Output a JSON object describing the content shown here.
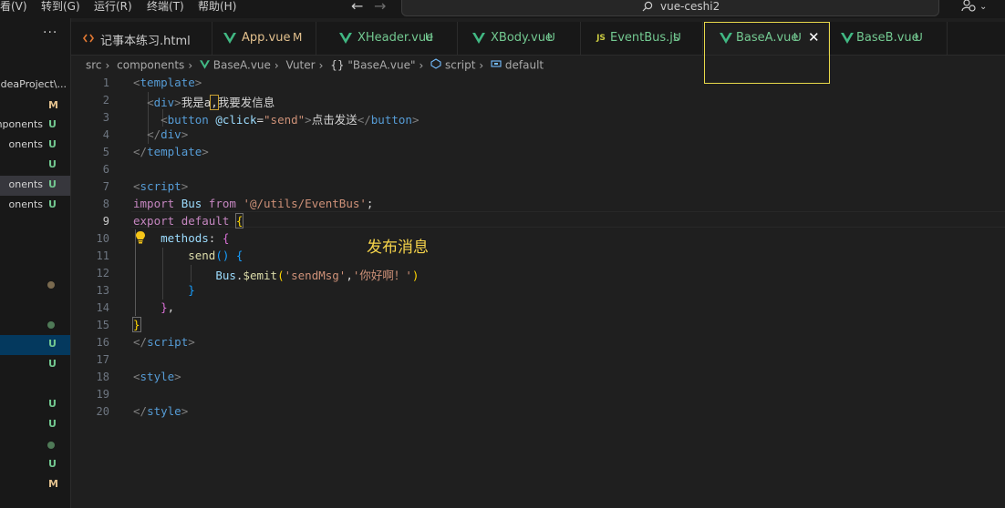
{
  "menu": [
    "看(V)",
    "转到(G)",
    "运行(R)",
    "终端(T)",
    "帮助(H)"
  ],
  "command_center": {
    "text": "vue-ceshi2"
  },
  "sidebar": {
    "rows": [
      {
        "label": "",
        "status": "M",
        "kind": "m"
      },
      {
        "label": "IdeaProject\\...",
        "status": "",
        "kind": ""
      },
      {
        "label": "mponents",
        "status": "U",
        "kind": "u"
      },
      {
        "label": "onents",
        "status": "U",
        "kind": "u"
      },
      {
        "label": "",
        "status": "U",
        "kind": "u"
      },
      {
        "label": "onents",
        "status": "U",
        "kind": "u"
      },
      {
        "label": "onents",
        "status": "U",
        "kind": "u"
      }
    ],
    "lower_status": [
      "U",
      "U",
      "U",
      "U",
      "U",
      "M"
    ]
  },
  "tabs": [
    {
      "label": "记事本练习.html",
      "status": "",
      "icon": "html-icon"
    },
    {
      "label": "App.vue",
      "status": "M",
      "icon": "vue-icon"
    },
    {
      "label": "XHeader.vue",
      "status": "U",
      "icon": "vue-icon"
    },
    {
      "label": "XBody.vue",
      "status": "U",
      "icon": "vue-icon"
    },
    {
      "label": "EventBus.js",
      "status": "U",
      "icon": "js-icon"
    },
    {
      "label": "BaseA.vue",
      "status": "U",
      "icon": "vue-icon"
    },
    {
      "label": "BaseB.vue",
      "status": "U",
      "icon": "vue-icon"
    }
  ],
  "tabs_js_badge": "JS",
  "breadcrumb": {
    "items": [
      "src",
      "components",
      "BaseA.vue",
      "Vuter",
      "\"BaseA.vue\"",
      "script",
      "default"
    ],
    "obj_prefix": "{}"
  },
  "editor": {
    "line_numbers": [
      "1",
      "2",
      "3",
      "4",
      "5",
      "6",
      "7",
      "8",
      "9",
      "10",
      "11",
      "12",
      "13",
      "14",
      "15",
      "16",
      "17",
      "18",
      "19",
      "20"
    ],
    "current_line": "9",
    "annotation": "发布消息",
    "tokens": {
      "tag_template": "template",
      "tag_div": "div",
      "div_text_a": "我是a",
      "div_text_comma": ",",
      "div_text_rest": "我要发信息",
      "tag_button": "button",
      "attr_click": "@click",
      "str_send": "\"send\"",
      "button_text": "点击发送",
      "tag_script": "script",
      "kw_import": "import",
      "id_bus": "Bus",
      "kw_from": "from",
      "str_path": "'@/utils/EventBus'",
      "kw_export": "export",
      "kw_default": "default",
      "prop_methods": "methods",
      "fn_send": "send",
      "fn_emit": "$emit",
      "str_sendmsg": "'sendMsg'",
      "str_hello": "'你好啊！'",
      "tag_style": "style"
    }
  }
}
